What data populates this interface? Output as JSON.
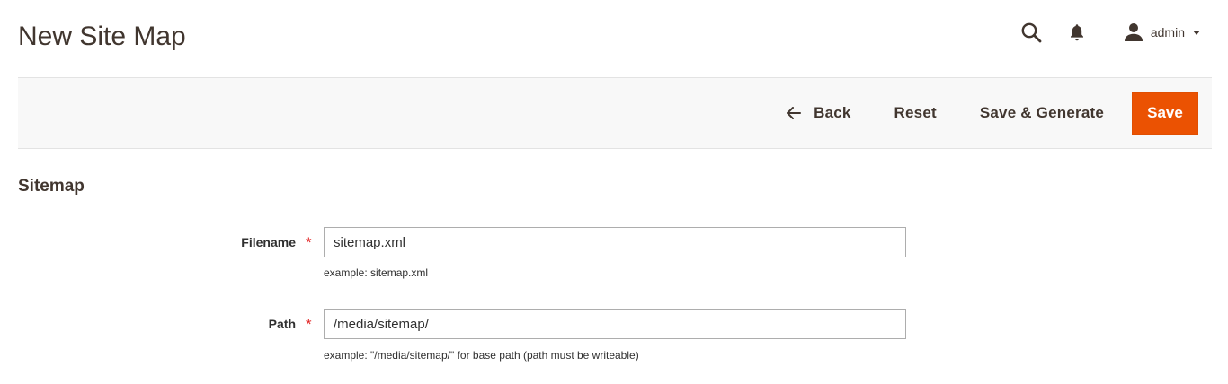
{
  "header": {
    "title": "New Site Map",
    "user_name": "admin"
  },
  "actions": {
    "back_label": "Back",
    "reset_label": "Reset",
    "save_generate_label": "Save & Generate",
    "save_label": "Save"
  },
  "section": {
    "title": "Sitemap"
  },
  "fields": {
    "filename": {
      "label": "Filename",
      "required_mark": "*",
      "value": "sitemap.xml",
      "note": "example: sitemap.xml"
    },
    "path": {
      "label": "Path",
      "required_mark": "*",
      "value": "/media/sitemap/",
      "note": "example: \"/media/sitemap/\" for base path (path must be writeable)"
    }
  },
  "colors": {
    "primary_action": "#eb5202",
    "text": "#41362f",
    "required": "#e22626",
    "toolbar_bg": "#f8f8f8"
  },
  "icons": {
    "search": "search-icon",
    "notifications": "bell-icon",
    "user": "user-icon",
    "caret": "caret-down-icon",
    "back": "arrow-left-icon"
  }
}
